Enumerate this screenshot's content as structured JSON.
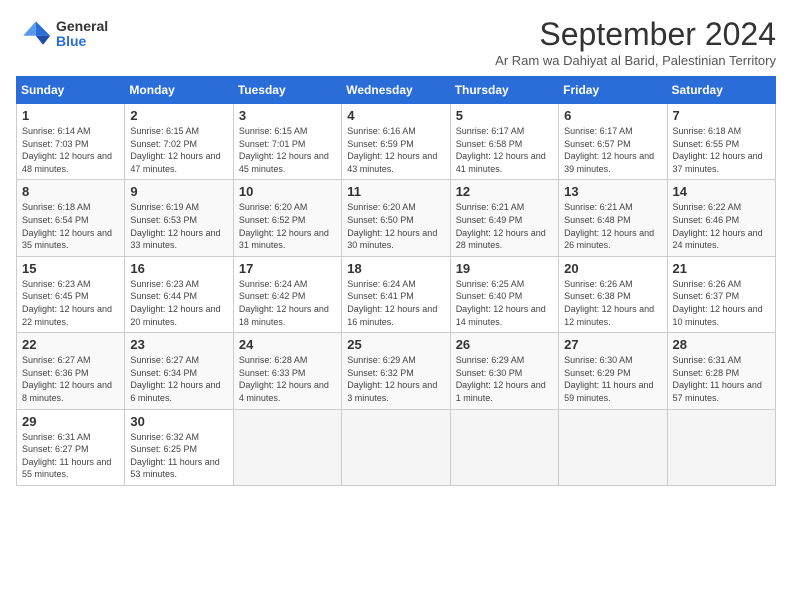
{
  "header": {
    "logo_general": "General",
    "logo_blue": "Blue",
    "month_title": "September 2024",
    "subtitle": "Ar Ram wa Dahiyat al Barid, Palestinian Territory"
  },
  "columns": [
    "Sunday",
    "Monday",
    "Tuesday",
    "Wednesday",
    "Thursday",
    "Friday",
    "Saturday"
  ],
  "weeks": [
    [
      {
        "day": "1",
        "sunrise": "6:14 AM",
        "sunset": "7:03 PM",
        "daylight": "12 hours and 48 minutes."
      },
      {
        "day": "2",
        "sunrise": "6:15 AM",
        "sunset": "7:02 PM",
        "daylight": "12 hours and 47 minutes."
      },
      {
        "day": "3",
        "sunrise": "6:15 AM",
        "sunset": "7:01 PM",
        "daylight": "12 hours and 45 minutes."
      },
      {
        "day": "4",
        "sunrise": "6:16 AM",
        "sunset": "6:59 PM",
        "daylight": "12 hours and 43 minutes."
      },
      {
        "day": "5",
        "sunrise": "6:17 AM",
        "sunset": "6:58 PM",
        "daylight": "12 hours and 41 minutes."
      },
      {
        "day": "6",
        "sunrise": "6:17 AM",
        "sunset": "6:57 PM",
        "daylight": "12 hours and 39 minutes."
      },
      {
        "day": "7",
        "sunrise": "6:18 AM",
        "sunset": "6:55 PM",
        "daylight": "12 hours and 37 minutes."
      }
    ],
    [
      {
        "day": "8",
        "sunrise": "6:18 AM",
        "sunset": "6:54 PM",
        "daylight": "12 hours and 35 minutes."
      },
      {
        "day": "9",
        "sunrise": "6:19 AM",
        "sunset": "6:53 PM",
        "daylight": "12 hours and 33 minutes."
      },
      {
        "day": "10",
        "sunrise": "6:20 AM",
        "sunset": "6:52 PM",
        "daylight": "12 hours and 31 minutes."
      },
      {
        "day": "11",
        "sunrise": "6:20 AM",
        "sunset": "6:50 PM",
        "daylight": "12 hours and 30 minutes."
      },
      {
        "day": "12",
        "sunrise": "6:21 AM",
        "sunset": "6:49 PM",
        "daylight": "12 hours and 28 minutes."
      },
      {
        "day": "13",
        "sunrise": "6:21 AM",
        "sunset": "6:48 PM",
        "daylight": "12 hours and 26 minutes."
      },
      {
        "day": "14",
        "sunrise": "6:22 AM",
        "sunset": "6:46 PM",
        "daylight": "12 hours and 24 minutes."
      }
    ],
    [
      {
        "day": "15",
        "sunrise": "6:23 AM",
        "sunset": "6:45 PM",
        "daylight": "12 hours and 22 minutes."
      },
      {
        "day": "16",
        "sunrise": "6:23 AM",
        "sunset": "6:44 PM",
        "daylight": "12 hours and 20 minutes."
      },
      {
        "day": "17",
        "sunrise": "6:24 AM",
        "sunset": "6:42 PM",
        "daylight": "12 hours and 18 minutes."
      },
      {
        "day": "18",
        "sunrise": "6:24 AM",
        "sunset": "6:41 PM",
        "daylight": "12 hours and 16 minutes."
      },
      {
        "day": "19",
        "sunrise": "6:25 AM",
        "sunset": "6:40 PM",
        "daylight": "12 hours and 14 minutes."
      },
      {
        "day": "20",
        "sunrise": "6:26 AM",
        "sunset": "6:38 PM",
        "daylight": "12 hours and 12 minutes."
      },
      {
        "day": "21",
        "sunrise": "6:26 AM",
        "sunset": "6:37 PM",
        "daylight": "12 hours and 10 minutes."
      }
    ],
    [
      {
        "day": "22",
        "sunrise": "6:27 AM",
        "sunset": "6:36 PM",
        "daylight": "12 hours and 8 minutes."
      },
      {
        "day": "23",
        "sunrise": "6:27 AM",
        "sunset": "6:34 PM",
        "daylight": "12 hours and 6 minutes."
      },
      {
        "day": "24",
        "sunrise": "6:28 AM",
        "sunset": "6:33 PM",
        "daylight": "12 hours and 4 minutes."
      },
      {
        "day": "25",
        "sunrise": "6:29 AM",
        "sunset": "6:32 PM",
        "daylight": "12 hours and 3 minutes."
      },
      {
        "day": "26",
        "sunrise": "6:29 AM",
        "sunset": "6:30 PM",
        "daylight": "12 hours and 1 minute."
      },
      {
        "day": "27",
        "sunrise": "6:30 AM",
        "sunset": "6:29 PM",
        "daylight": "11 hours and 59 minutes."
      },
      {
        "day": "28",
        "sunrise": "6:31 AM",
        "sunset": "6:28 PM",
        "daylight": "11 hours and 57 minutes."
      }
    ],
    [
      {
        "day": "29",
        "sunrise": "6:31 AM",
        "sunset": "6:27 PM",
        "daylight": "11 hours and 55 minutes."
      },
      {
        "day": "30",
        "sunrise": "6:32 AM",
        "sunset": "6:25 PM",
        "daylight": "11 hours and 53 minutes."
      },
      null,
      null,
      null,
      null,
      null
    ]
  ]
}
